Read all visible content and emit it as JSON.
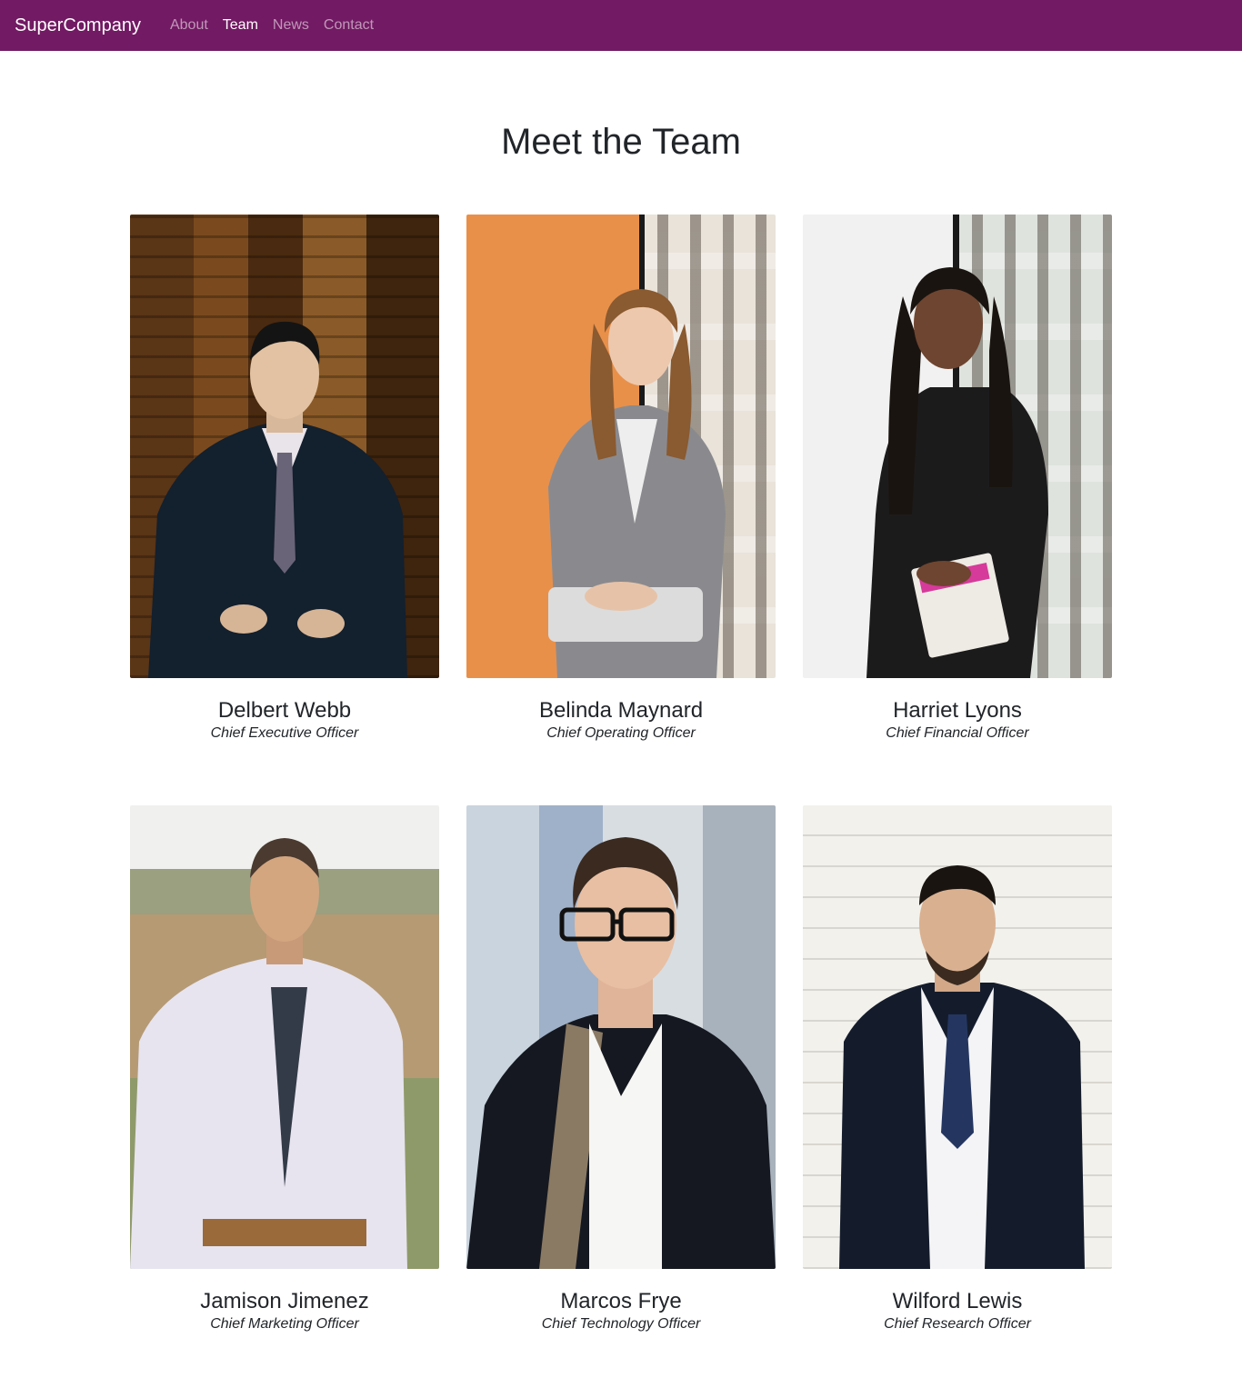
{
  "nav": {
    "brand": "SuperCompany",
    "links": [
      {
        "label": "About",
        "active": false
      },
      {
        "label": "Team",
        "active": true
      },
      {
        "label": "News",
        "active": false
      },
      {
        "label": "Contact",
        "active": false
      }
    ],
    "bar_color": "#721a63"
  },
  "page": {
    "title": "Meet the Team"
  },
  "team": [
    {
      "name": "Delbert Webb",
      "role": "Chief Executive Officer"
    },
    {
      "name": "Belinda Maynard",
      "role": "Chief Operating Officer"
    },
    {
      "name": "Harriet Lyons",
      "role": "Chief Financial Officer"
    },
    {
      "name": "Jamison Jimenez",
      "role": "Chief Marketing Officer"
    },
    {
      "name": "Marcos Frye",
      "role": "Chief Technology Officer"
    },
    {
      "name": "Wilford Lewis",
      "role": "Chief Research Officer"
    }
  ]
}
